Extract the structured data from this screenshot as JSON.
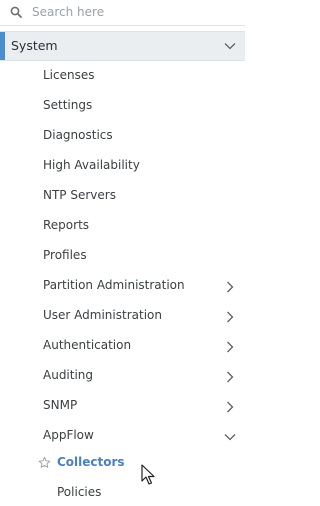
{
  "search": {
    "placeholder": "Search here",
    "value": ""
  },
  "section": {
    "label": "System",
    "expanded": true,
    "accent_color": "#4a8ecf"
  },
  "items": [
    {
      "label": "Licenses",
      "has_children": false
    },
    {
      "label": "Settings",
      "has_children": false
    },
    {
      "label": "Diagnostics",
      "has_children": false
    },
    {
      "label": "High Availability",
      "has_children": false
    },
    {
      "label": "NTP Servers",
      "has_children": false
    },
    {
      "label": "Reports",
      "has_children": false
    },
    {
      "label": "Profiles",
      "has_children": false
    },
    {
      "label": "Partition Administration",
      "has_children": true,
      "expanded": false
    },
    {
      "label": "User Administration",
      "has_children": true,
      "expanded": false
    },
    {
      "label": "Authentication",
      "has_children": true,
      "expanded": false
    },
    {
      "label": "Auditing",
      "has_children": true,
      "expanded": false
    },
    {
      "label": "SNMP",
      "has_children": true,
      "expanded": false
    },
    {
      "label": "AppFlow",
      "has_children": true,
      "expanded": true
    }
  ],
  "appflow_children": [
    {
      "label": "Collectors",
      "active": true,
      "icon": "star-icon"
    },
    {
      "label": "Policies",
      "active": false
    }
  ],
  "colors": {
    "active_link": "#4a7fc0",
    "section_bg": "#eaeef1"
  }
}
